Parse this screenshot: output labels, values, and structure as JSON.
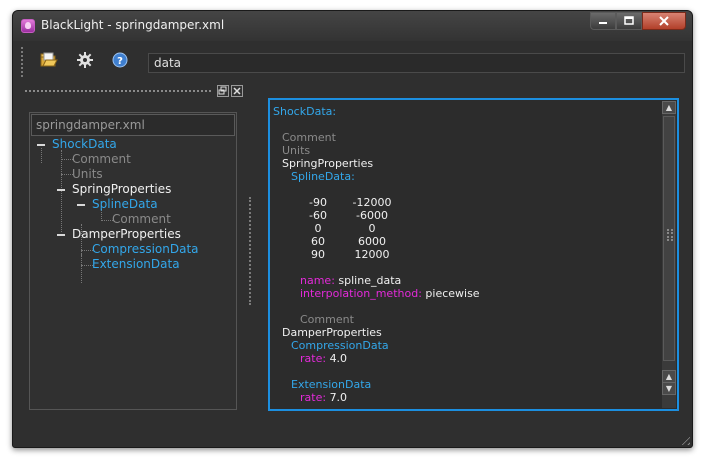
{
  "window": {
    "title": "BlackLight - springdamper.xml"
  },
  "toolbar": {
    "search_value": "data"
  },
  "tree": {
    "header": "springdamper.xml",
    "nodes": {
      "shockdata": "ShockData",
      "comment": "Comment",
      "units": "Units",
      "springproperties": "SpringProperties",
      "splinedata": "SplineData",
      "spline_comment": "Comment",
      "damperproperties": "DamperProperties",
      "compressiondata": "CompressionData",
      "extensiondata": "ExtensionData"
    }
  },
  "editor": {
    "root": "ShockData:",
    "comment1": "Comment",
    "units": "Units",
    "spring": "SpringProperties",
    "spline": "SplineData:",
    "table": {
      "col1": [
        "-90",
        "-60",
        "0",
        "60",
        "90"
      ],
      "col2": [
        "-12000",
        "-6000",
        "0",
        "6000",
        "12000"
      ]
    },
    "name_key": "name:",
    "name_val": "spline_data",
    "interp_key": "interpolation_method:",
    "interp_val": "piecewise",
    "comment2": "Comment",
    "damper": "DamperProperties",
    "compression": "CompressionData",
    "rate_key1": "rate:",
    "rate_val1": "4.0",
    "extension": "ExtensionData",
    "rate_key2": "rate:",
    "rate_val2": "7.0"
  },
  "colors": {
    "accent": "#1c8fe0",
    "key_magenta": "#e32ad9",
    "node_blue": "#33a7ea",
    "background": "#2f2f2f"
  },
  "icons": [
    "open-folder-icon",
    "gear-icon",
    "help-icon",
    "minimize-icon",
    "maximize-icon",
    "close-icon"
  ]
}
